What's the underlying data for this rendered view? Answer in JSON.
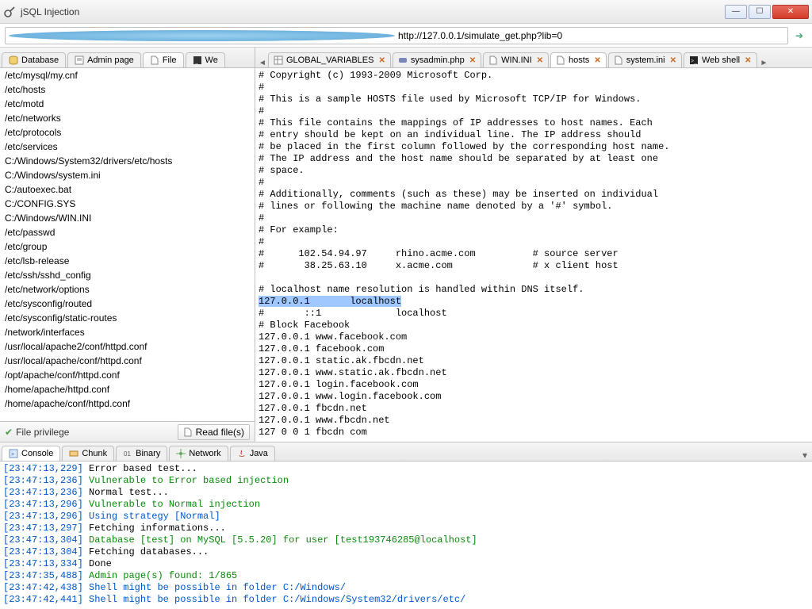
{
  "window": {
    "title": "jSQL Injection"
  },
  "url": "http://127.0.0.1/simulate_get.php?lib=0",
  "tooltip": "C:/Windows/System32/drivers/etc/hosts",
  "leftTabs": [
    {
      "label": "Database"
    },
    {
      "label": "Admin page"
    },
    {
      "label": "File"
    },
    {
      "label": "We"
    }
  ],
  "fileList": [
    "/etc/mysql/my.cnf",
    "/etc/hosts",
    "/etc/motd",
    "/etc/networks",
    "/etc/protocols",
    "/etc/services",
    "C:/Windows/System32/drivers/etc/hosts",
    "C:/Windows/system.ini",
    "C:/autoexec.bat",
    "C:/CONFIG.SYS",
    "C:/Windows/WIN.INI",
    "/etc/passwd",
    "/etc/group",
    "/etc/lsb-release",
    "/etc/ssh/sshd_config",
    "/etc/network/options",
    "/etc/sysconfig/routed",
    "/etc/sysconfig/static-routes",
    "/network/interfaces",
    "/usr/local/apache2/conf/httpd.conf",
    "/usr/local/apache/conf/httpd.conf",
    "/opt/apache/conf/httpd.conf",
    "/home/apache/httpd.conf",
    "/home/apache/conf/httpd.conf"
  ],
  "leftFooter": {
    "priv": "File privilege",
    "read": "Read file(s)"
  },
  "rightTabs": [
    {
      "label": "GLOBAL_VARIABLES",
      "icon": "table"
    },
    {
      "label": "sysadmin.php",
      "icon": "php"
    },
    {
      "label": "WIN.INI",
      "icon": "file"
    },
    {
      "label": "hosts",
      "icon": "file",
      "active": true
    },
    {
      "label": "system.ini",
      "icon": "file"
    },
    {
      "label": "Web shell",
      "icon": "shell"
    }
  ],
  "fileContent": {
    "before": "# Copyright (c) 1993-2009 Microsoft Corp.\n#\n# This is a sample HOSTS file used by Microsoft TCP/IP for Windows.\n#\n# This file contains the mappings of IP addresses to host names. Each\n# entry should be kept on an individual line. The IP address should\n# be placed in the first column followed by the corresponding host name.\n# The IP address and the host name should be separated by at least one\n# space.\n#\n# Additionally, comments (such as these) may be inserted on individual\n# lines or following the machine name denoted by a '#' symbol.\n#\n# For example:\n#\n#      102.54.94.97     rhino.acme.com          # source server\n#       38.25.63.10     x.acme.com              # x client host\n\n# localhost name resolution is handled within DNS itself.\n",
    "highlight": "127.0.0.1       localhost",
    "after": "\n#       ::1             localhost\n# Block Facebook\n127.0.0.1 www.facebook.com\n127.0.0.1 facebook.com\n127.0.0.1 static.ak.fbcdn.net\n127.0.0.1 www.static.ak.fbcdn.net\n127.0.0.1 login.facebook.com\n127.0.0.1 www.login.facebook.com\n127.0.0.1 fbcdn.net\n127.0.0.1 www.fbcdn.net\n127 0 0 1 fbcdn com"
  },
  "bottomTabs": [
    {
      "label": "Console"
    },
    {
      "label": "Chunk"
    },
    {
      "label": "Binary"
    },
    {
      "label": "Network"
    },
    {
      "label": "Java"
    }
  ],
  "console": [
    {
      "ts": "[23:47:13,229]",
      "msg": " Error based test...",
      "cls": "gray"
    },
    {
      "ts": "[23:47:13,236]",
      "msg": " Vulnerable to Error based injection",
      "cls": "green"
    },
    {
      "ts": "[23:47:13,236]",
      "msg": " Normal test...",
      "cls": "gray"
    },
    {
      "ts": "[23:47:13,296]",
      "msg": " Vulnerable to Normal injection",
      "cls": "green"
    },
    {
      "ts": "[23:47:13,296]",
      "msg": " Using strategy [Normal]",
      "cls": "blue"
    },
    {
      "ts": "[23:47:13,297]",
      "msg": " Fetching informations...",
      "cls": "gray"
    },
    {
      "ts": "[23:47:13,304]",
      "msg": " Database [test] on MySQL [5.5.20] for user [test193746285@localhost]",
      "cls": "green"
    },
    {
      "ts": "[23:47:13,304]",
      "msg": " Fetching databases...",
      "cls": "gray"
    },
    {
      "ts": "[23:47:13,334]",
      "msg": " Done",
      "cls": "gray"
    },
    {
      "ts": "[23:47:35,488]",
      "msg": " Admin page(s) found: 1/865",
      "cls": "green"
    },
    {
      "ts": "[23:47:42,438]",
      "msg": " Shell might be possible in folder C:/Windows/",
      "cls": "blue"
    },
    {
      "ts": "[23:47:42,441]",
      "msg": " Shell might be possible in folder C:/Windows/System32/drivers/etc/",
      "cls": "blue"
    }
  ]
}
